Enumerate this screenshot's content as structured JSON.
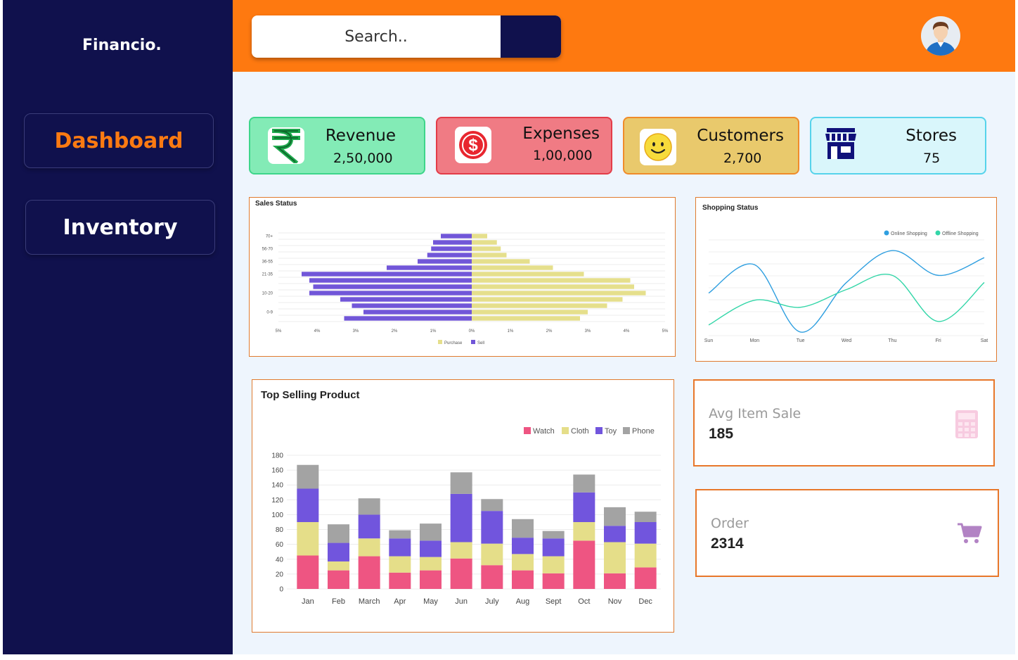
{
  "app": {
    "brand": "Financio."
  },
  "sidebar": {
    "items": [
      {
        "label": "Dashboard",
        "active": true
      },
      {
        "label": "Inventory",
        "active": false
      }
    ]
  },
  "header": {
    "search_placeholder": "Search..",
    "avatar": "user-avatar-icon"
  },
  "cards": [
    {
      "title": "Revenue",
      "value": "2,50,000",
      "icon": "rupee-icon",
      "color": "#83ebb6"
    },
    {
      "title": "Expenses",
      "value": "1,00,000",
      "icon": "dollar-icon",
      "color": "#f07b84"
    },
    {
      "title": "Customers",
      "value": "2,700",
      "icon": "smiley-icon",
      "color": "#e9c96c"
    },
    {
      "title": "Stores",
      "value": "75",
      "icon": "store-icon",
      "color": "#d9f6fb"
    }
  ],
  "kpis": {
    "avg_item_sale": {
      "label": "Avg Item Sale",
      "value": "185",
      "icon": "calculator-icon"
    },
    "order": {
      "label": "Order",
      "value": "2314",
      "icon": "cart-icon"
    }
  },
  "chart_data": [
    {
      "type": "bar",
      "orientation": "horizontal",
      "title": "Sales Status",
      "categories": [
        "70+",
        "",
        "56-70",
        "",
        "36-55",
        "",
        "21-35",
        "",
        "",
        "10-20",
        "",
        "",
        "0-9",
        ""
      ],
      "category_ticks": [
        "70+",
        "56-70",
        "36-55",
        "21-35",
        "10-20",
        "0-9"
      ],
      "x_ticks": [
        "5%",
        "4%",
        "3%",
        "2%",
        "1%",
        "0%",
        "1%",
        "2%",
        "3%",
        "4%",
        "5%"
      ],
      "xlim": [
        -5,
        5
      ],
      "series": [
        {
          "name": "Sell",
          "color": "#7156d8",
          "values": [
            -0.8,
            -1.0,
            -1.05,
            -1.15,
            -1.4,
            -2.2,
            -4.4,
            -4.2,
            -4.1,
            -4.2,
            -3.4,
            -3.1,
            -2.8,
            -3.3
          ]
        },
        {
          "name": "Purchase",
          "color": "#e5df8c",
          "values": [
            0.4,
            0.65,
            0.75,
            0.9,
            1.5,
            2.1,
            2.9,
            4.1,
            4.2,
            4.5,
            3.9,
            3.5,
            3.0,
            2.8
          ]
        }
      ],
      "legend": [
        "Purchase",
        "Sell"
      ],
      "legend_position": "bottom"
    },
    {
      "type": "line",
      "title": "Shopping Status",
      "x": [
        "Sun",
        "Mon",
        "Tue",
        "Wed",
        "Thu",
        "Fri",
        "Sat"
      ],
      "series": [
        {
          "name": "Online Shopping",
          "color": "#2f9fe0",
          "values": [
            55,
            95,
            0,
            70,
            115,
            80,
            105
          ]
        },
        {
          "name": "Offline Shopping",
          "color": "#33d6a8",
          "values": [
            10,
            45,
            35,
            60,
            80,
            15,
            70
          ]
        }
      ],
      "ylim": [
        -5,
        130
      ],
      "legend_position": "top-right",
      "grid": true
    },
    {
      "type": "bar",
      "stacked": true,
      "title": "Top Selling Product",
      "categories": [
        "Jan",
        "Feb",
        "March",
        "Apr",
        "May",
        "Jun",
        "July",
        "Aug",
        "Sept",
        "Oct",
        "Nov",
        "Dec"
      ],
      "series": [
        {
          "name": "Watch",
          "color": "#ee5582",
          "values": [
            45,
            25,
            44,
            22,
            25,
            41,
            32,
            25,
            21,
            65,
            21,
            29
          ]
        },
        {
          "name": "Cloth",
          "color": "#e5de89",
          "values": [
            45,
            12,
            24,
            22,
            18,
            22,
            29,
            22,
            23,
            25,
            42,
            32
          ]
        },
        {
          "name": "Toy",
          "color": "#7155dd",
          "values": [
            45,
            25,
            32,
            24,
            22,
            65,
            44,
            22,
            24,
            40,
            22,
            29
          ]
        },
        {
          "name": "Phone",
          "color": "#a3a3a3",
          "values": [
            32,
            25,
            22,
            11,
            23,
            29,
            16,
            25,
            10,
            24,
            25,
            14
          ]
        }
      ],
      "ylim": [
        0,
        180
      ],
      "yticks": [
        0,
        20,
        40,
        60,
        80,
        100,
        120,
        140,
        160,
        180
      ],
      "legend_position": "top-right",
      "grid": true
    }
  ]
}
